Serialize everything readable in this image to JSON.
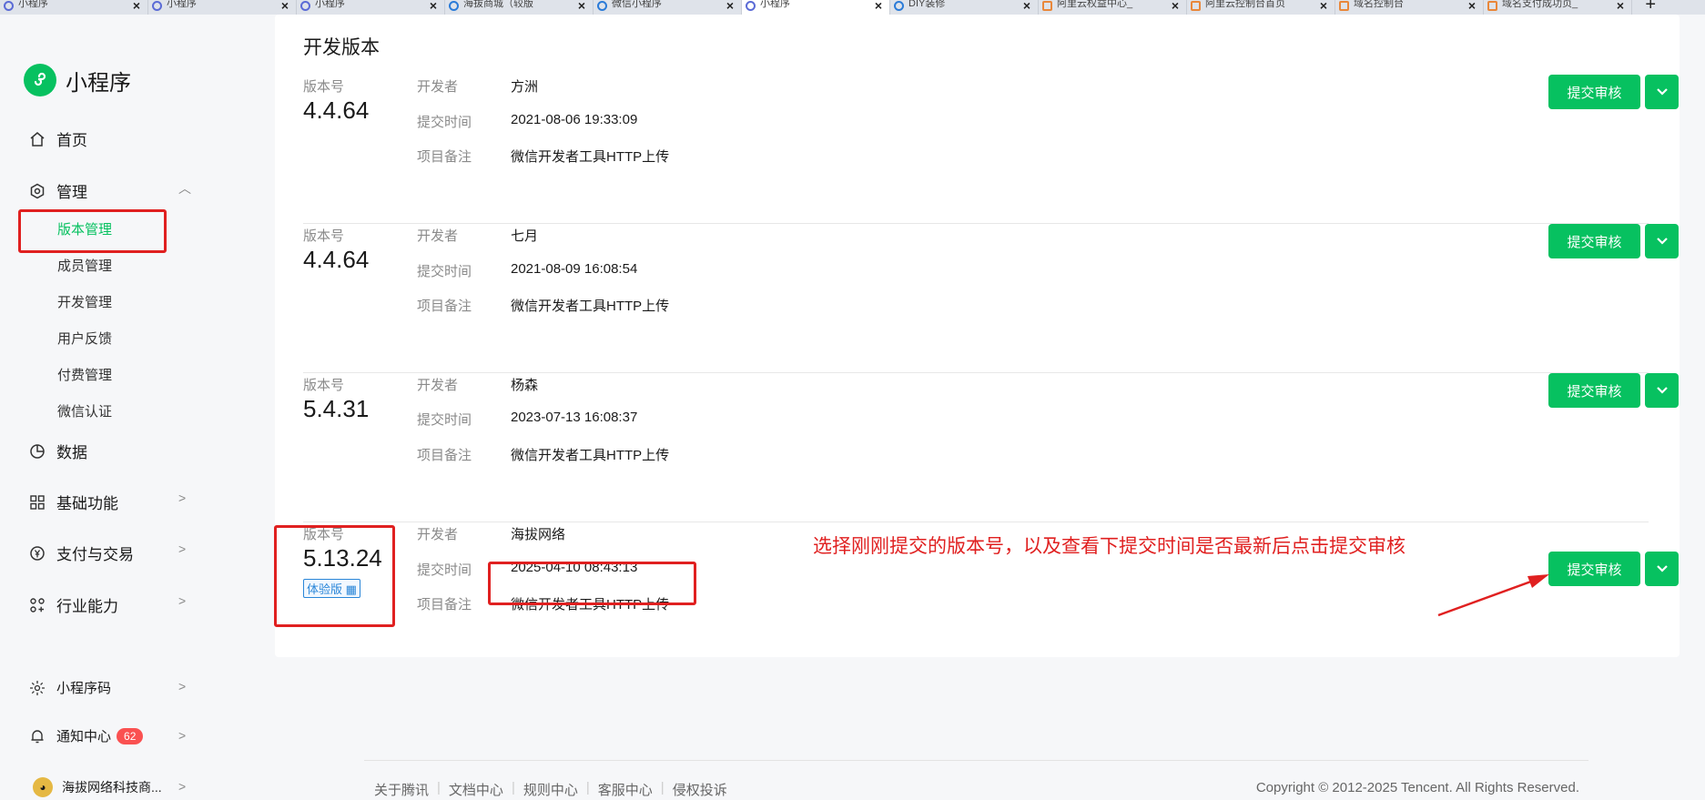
{
  "tabs": [
    {
      "label": "小程序",
      "icon": "miniprogram-tab-icon"
    },
    {
      "label": "小程序",
      "icon": "miniprogram-tab-icon"
    },
    {
      "label": "小程序",
      "icon": "miniprogram-tab-icon"
    },
    {
      "label": "海拔商城（较版",
      "icon": "wechat-tab-icon"
    },
    {
      "label": "微信小程序",
      "icon": "wechat-tab-icon"
    },
    {
      "label": "小程序",
      "icon": "miniprogram-tab-icon",
      "active": true
    },
    {
      "label": "DIY装修",
      "icon": "wechat-tab-icon"
    },
    {
      "label": "阿里云权益中心_",
      "icon": "aliyun-tab-icon"
    },
    {
      "label": "阿里云控制台首页",
      "icon": "aliyun-tab-icon"
    },
    {
      "label": "域名控制台",
      "icon": "aliyun-tab-icon"
    },
    {
      "label": "域名支付成功页_",
      "icon": "aliyun-tab-icon"
    }
  ],
  "brand": {
    "name": "小程序"
  },
  "sidebar": {
    "home": "首页",
    "manage": "管理",
    "manage_items": [
      "版本管理",
      "成员管理",
      "开发管理",
      "用户反馈",
      "付费管理",
      "微信认证"
    ],
    "data": "数据",
    "basic": "基础功能",
    "payment": "支付与交易",
    "industry": "行业能力",
    "qrcode": "小程序码",
    "notice": "通知中心",
    "notice_count": "62",
    "account": "海拔网络科技商..."
  },
  "main": {
    "section_title": "开发版本",
    "labels": {
      "version": "版本号",
      "developer": "开发者",
      "submit_time": "提交时间",
      "remark": "项目备注"
    },
    "submit_label": "提交审核",
    "versions": [
      {
        "version": "4.4.64",
        "developer": "方洲",
        "time": "2021-08-06 19:33:09",
        "remark": "微信开发者工具HTTP上传"
      },
      {
        "version": "4.4.64",
        "developer": "七月",
        "time": "2021-08-09 16:08:54",
        "remark": "微信开发者工具HTTP上传"
      },
      {
        "version": "5.4.31",
        "developer": "杨森",
        "time": "2023-07-13 16:08:37",
        "remark": "微信开发者工具HTTP上传"
      },
      {
        "version": "5.13.24",
        "developer": "海拔网络",
        "time": "2025-04-10 08:43:13",
        "remark": "微信开发者工具HTTP上传",
        "tag": "体验版"
      }
    ]
  },
  "annotation": {
    "text": "选择刚刚提交的版本号，以及查看下提交时间是否最新后点击提交审核",
    "color": "#e02020"
  },
  "footer": {
    "links": [
      "关于腾讯",
      "文档中心",
      "规则中心",
      "客服中心",
      "侵权投诉"
    ],
    "copyright": "Copyright © 2012-2025 Tencent. All Rights Reserved."
  },
  "colors": {
    "accent": "#07c160",
    "badge": "#fa5151"
  }
}
